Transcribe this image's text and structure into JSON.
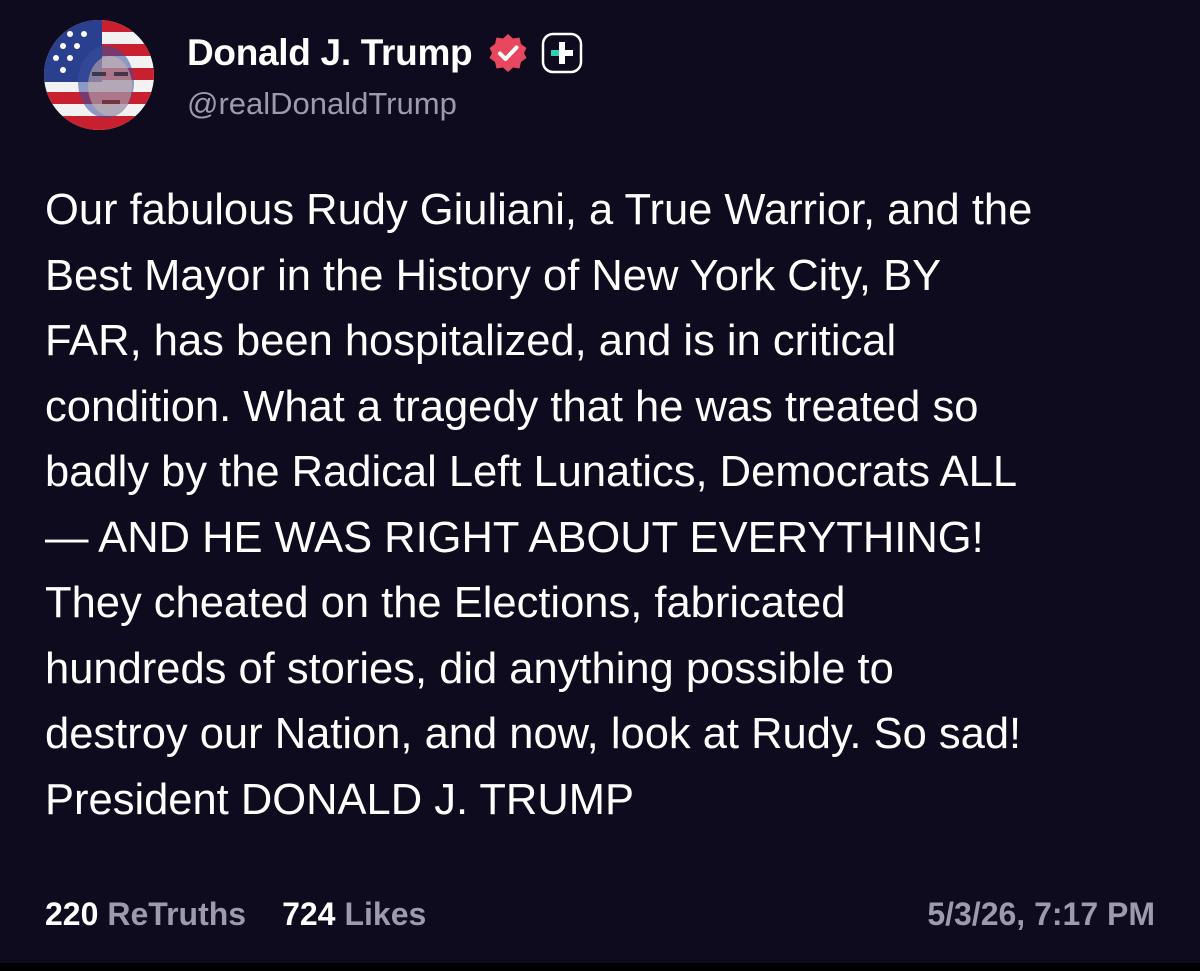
{
  "post": {
    "author": {
      "display_name": "Donald J. Trump",
      "handle": "@realDonaldTrump",
      "avatar_icon": "user-avatar",
      "verified_icon": "verified-badge-icon",
      "badge_icon": "plus-badge-icon"
    },
    "text": "Our fabulous Rudy Giuliani, a True Warrior, and the\nBest Mayor in the History of New York City, BY\nFAR, has been hospitalized, and is in critical\ncondition. What a tragedy that he was treated so\nbadly by the Radical Left Lunatics, Democrats ALL\n— AND HE WAS RIGHT ABOUT EVERYTHING!\nThey cheated on the Elections, fabricated\nhundreds of stories, did anything possible to\ndestroy our Nation, and now, look at Rudy. So sad!\nPresident DONALD J. TRUMP",
    "stats": {
      "retruths_count": "220",
      "retruths_label": "ReTruths",
      "likes_count": "724",
      "likes_label": "Likes"
    },
    "timestamp": "5/3/26, 7:17 PM"
  },
  "colors": {
    "background": "#0d0b1d",
    "text_primary": "#ffffff",
    "text_secondary": "#9c9aab",
    "verified_badge": "#e8485f",
    "plus_badge": "#2fd1b5"
  }
}
